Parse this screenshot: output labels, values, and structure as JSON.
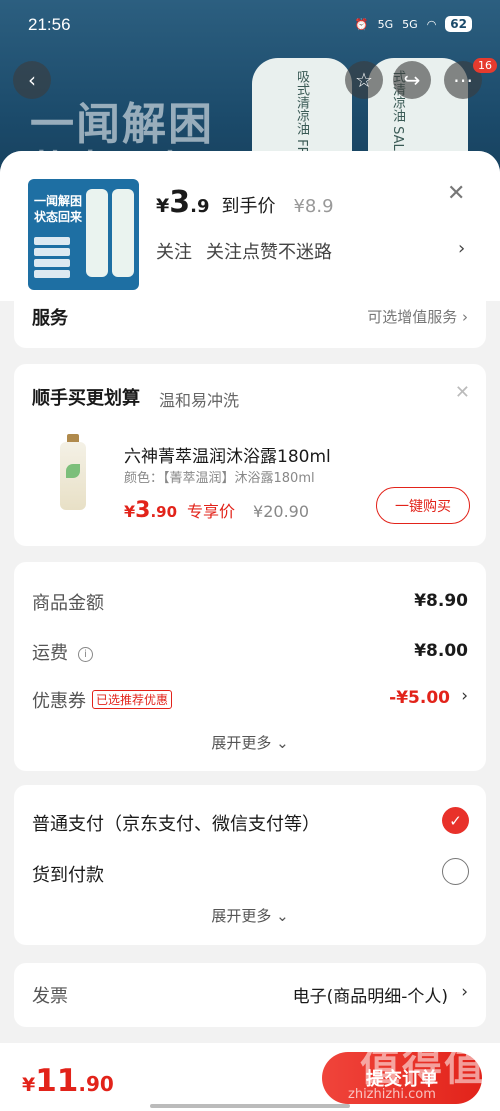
{
  "status": {
    "time": "21:56",
    "signal_a": "5G",
    "signal_b": "5G",
    "battery": "62"
  },
  "background": {
    "headline_1": "一闻解困",
    "headline_2": "状态回来",
    "bottle_text_1": "吸式清凉油 FRESHING",
    "bottle_text_2": "式清凉油 SAL INHZILER"
  },
  "topbar": {
    "notification_count": "16"
  },
  "product": {
    "thumb_line_1": "一闻解困",
    "thumb_line_2": "状态回来",
    "price_symbol": "¥",
    "price_int": "3",
    "price_dec": ".9",
    "price_label": "到手价",
    "original_price": "¥8.9",
    "follow_1": "关注",
    "follow_2": "关注点赞不迷路"
  },
  "service": {
    "title": "服务",
    "value": "可选增值服务"
  },
  "bundle": {
    "title": "顺手买更划算",
    "subtitle": "温和易冲洗",
    "item_name": "六神菁萃温润沐浴露180ml",
    "item_attr": "颜色：【菁萃温润】沐浴露180ml",
    "price_symbol": "¥",
    "price_int": "3",
    "price_dec": ".90",
    "price_label": "专享价",
    "original_price": "¥20.90",
    "buy_label": "一键购买"
  },
  "summary": {
    "goods_label": "商品金额",
    "goods_value": "¥8.90",
    "shipping_label": "运费",
    "shipping_value": "¥8.00",
    "coupon_label": "优惠券",
    "coupon_tag": "已选推荐优惠",
    "coupon_value": "-¥5.00",
    "expand_label": "展开更多"
  },
  "payment": {
    "option_1": "普通支付（京东支付、微信支付等）",
    "option_2": "货到付款",
    "selected": "option_1",
    "expand_label": "展开更多"
  },
  "invoice": {
    "label": "发票",
    "value": "电子(商品明细-个人)"
  },
  "footer": {
    "total_symbol": "¥",
    "total_int": "11",
    "total_dec": ".90",
    "submit_label": "提交订单",
    "watermark": "值得值",
    "watermark_url": "zhizhizhi.com"
  }
}
